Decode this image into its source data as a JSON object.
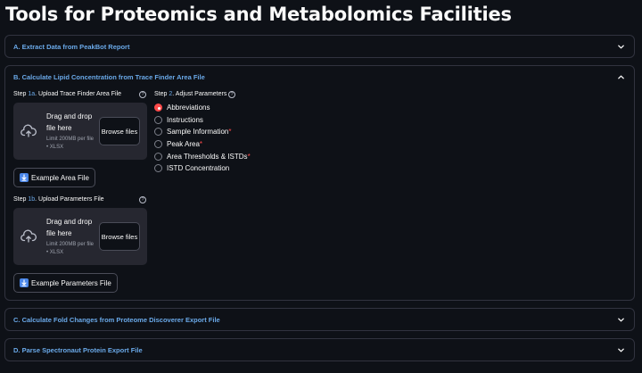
{
  "page": {
    "title": "Tools for Proteomics and Metabolomics Facilities"
  },
  "sections": {
    "a": {
      "label": "A. Extract Data from PeakBot Report"
    },
    "b": {
      "label": "B. Calculate Lipid Concentration from Trace Finder Area File"
    },
    "c": {
      "label": "C. Calculate Fold Changes from Proteome Discoverer Export File"
    },
    "d": {
      "label": "D. Parse Spectronaut Protein Export File"
    }
  },
  "step1a": {
    "prefix": "Step ",
    "num": "1a",
    "text": ". Upload Trace Finder Area File",
    "drop_text": "Drag and drop file here",
    "limit_text": "Limit 200MB per file • XLSX",
    "browse_label": "Browse files",
    "example_button": "Example Area File"
  },
  "step1b": {
    "prefix": "Step ",
    "num": "1b",
    "text": ". Upload Parameters File",
    "drop_text": "Drag and drop file here",
    "limit_text": "Limit 200MB per file • XLSX",
    "browse_label": "Browse files",
    "example_button": "Example Parameters File"
  },
  "step2": {
    "prefix": "Step ",
    "num": "2",
    "text": ". Adjust Parameters",
    "options": [
      {
        "label": "Abbreviations",
        "required": "",
        "selected": true
      },
      {
        "label": "Instructions",
        "required": "",
        "selected": false
      },
      {
        "label": "Sample Information",
        "required": "*",
        "selected": false
      },
      {
        "label": "Peak Area",
        "required": "*",
        "selected": false
      },
      {
        "label": "Area Thresholds & ISTDs",
        "required": "*",
        "selected": false
      },
      {
        "label": "ISTD Concentration",
        "required": "",
        "selected": false
      }
    ]
  },
  "help_icon_glyph": "?",
  "colors": {
    "background": "#0e1117",
    "accent_blue": "#6aa9e9",
    "radio_selected": "#ff4b4b",
    "dropzone": "#262730"
  }
}
